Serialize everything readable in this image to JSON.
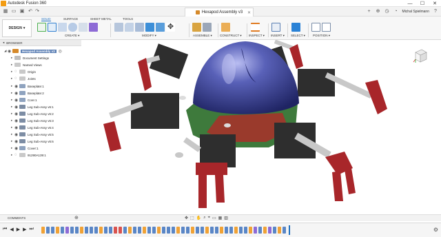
{
  "window": {
    "title": "Autodesk Fusion 360",
    "controls": [
      "—",
      "☐",
      "✕"
    ]
  },
  "document_tab": {
    "label": "Hexapod Assembly v3"
  },
  "user": {
    "name": "Michal Spielmann"
  },
  "workspace": {
    "label": "DESIGN",
    "caret": "▾"
  },
  "toolbar_tabs": [
    "SOLID",
    "SURFACE",
    "SHEET METAL",
    "TOOLS"
  ],
  "toolbar_groups": [
    {
      "label": "CREATE ▾"
    },
    {
      "label": "MODIFY ▾"
    },
    {
      "label": "ASSEMBLE ▾"
    },
    {
      "label": "CONSTRUCT ▾"
    },
    {
      "label": "INSPECT ▾"
    },
    {
      "label": "INSERT ▾"
    },
    {
      "label": "SELECT ▾"
    },
    {
      "label": "POSITION ▾"
    }
  ],
  "browser": {
    "title": "BROWSER",
    "items": [
      {
        "label": "Hexapod Assembly v3",
        "kind": "root"
      },
      {
        "label": "Document Settings",
        "kind": "settings"
      },
      {
        "label": "Named Views",
        "kind": "folder"
      },
      {
        "label": "Origin",
        "kind": "folder"
      },
      {
        "label": "Joints",
        "kind": "folder"
      },
      {
        "label": "Baseplate:1",
        "kind": "component"
      },
      {
        "label": "Baseplate:2",
        "kind": "component"
      },
      {
        "label": "Core:1",
        "kind": "component"
      },
      {
        "label": "Leg Sub-Assy v6:1",
        "kind": "link"
      },
      {
        "label": "Leg Sub-Assy v6:2",
        "kind": "link"
      },
      {
        "label": "Leg Sub-Assy v6:3",
        "kind": "link"
      },
      {
        "label": "Leg Sub-Assy v6:4",
        "kind": "link"
      },
      {
        "label": "Leg Sub-Assy v6:5",
        "kind": "link"
      },
      {
        "label": "Leg Sub-Assy v6:6",
        "kind": "link"
      },
      {
        "label": "Cover:1",
        "kind": "component"
      },
      {
        "label": "91290A139:1",
        "kind": "component"
      }
    ]
  },
  "comments": {
    "label": "COMMENTS"
  },
  "colors": {
    "accent": "#1f6fbf",
    "dome": "#3a4290",
    "body_green": "#3e7a3c",
    "leg_red": "#a8262a",
    "servo_black": "#2e2e2e"
  }
}
